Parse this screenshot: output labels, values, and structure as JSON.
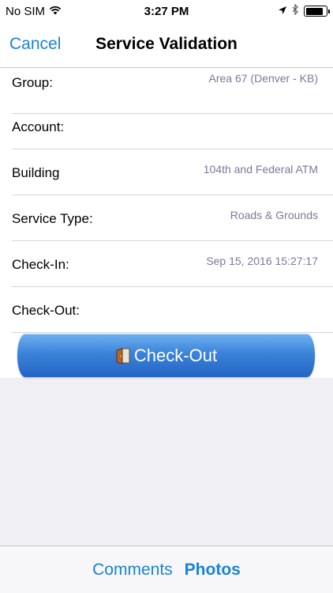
{
  "status_bar": {
    "carrier": "No SIM",
    "time": "3:27 PM",
    "icons": [
      "wifi-icon",
      "location-arrow-icon",
      "bluetooth-icon",
      "battery-icon"
    ],
    "battery_level": 0.85
  },
  "nav": {
    "cancel_label": "Cancel",
    "title": "Service Validation"
  },
  "form": {
    "rows": [
      {
        "label": "Group:",
        "value": "Area 67 (Denver - KB)"
      },
      {
        "label": "Account:",
        "value": ""
      },
      {
        "label": "Building",
        "value": "104th and Federal ATM"
      },
      {
        "label": "Service Type:",
        "value": "Roads & Grounds"
      },
      {
        "label": "Check-In:",
        "value": "Sep 15, 2016 15:27:17"
      },
      {
        "label": "Check-Out:",
        "value": ""
      }
    ]
  },
  "checkout_button": {
    "label": "Check-Out",
    "icon": "door-exit-icon"
  },
  "tab_bar": {
    "comments_label": "Comments",
    "photos_label": "Photos"
  },
  "colors": {
    "accent": "#1a82d8",
    "value_text": "#7a7a9a",
    "button_gradient_top": "#6fb1f0",
    "button_gradient_bottom": "#2464c4",
    "background": "#efeff4"
  }
}
